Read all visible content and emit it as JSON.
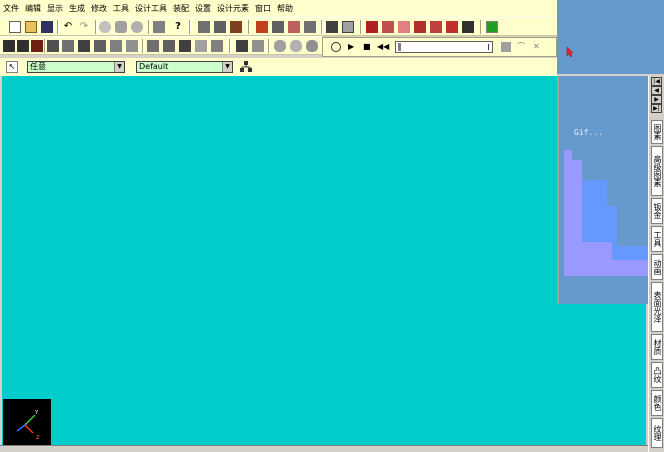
{
  "menu": [
    "文件",
    "编辑",
    "显示",
    "生成",
    "修改",
    "工具",
    "设计工具",
    "装配",
    "设置",
    "设计元素",
    "窗口",
    "帮助"
  ],
  "selection": {
    "filter_value": "任意",
    "style_value": "Default"
  },
  "preview": {
    "label": "Gif..."
  },
  "task_tabs": [
    "图素",
    "高级图素",
    "钣金",
    "工具",
    "动画",
    "表面光泽",
    "材质",
    "凸纹",
    "颜色",
    "纹理"
  ],
  "triad": {
    "axis_labels": [
      "Y",
      "Z"
    ]
  },
  "colors": {
    "viewport": "#00cccc",
    "toolbar": "#ffffcc",
    "preview_bg": "#6699cc",
    "stair_light": "#9999ff",
    "stair_mid": "#6699ff"
  }
}
